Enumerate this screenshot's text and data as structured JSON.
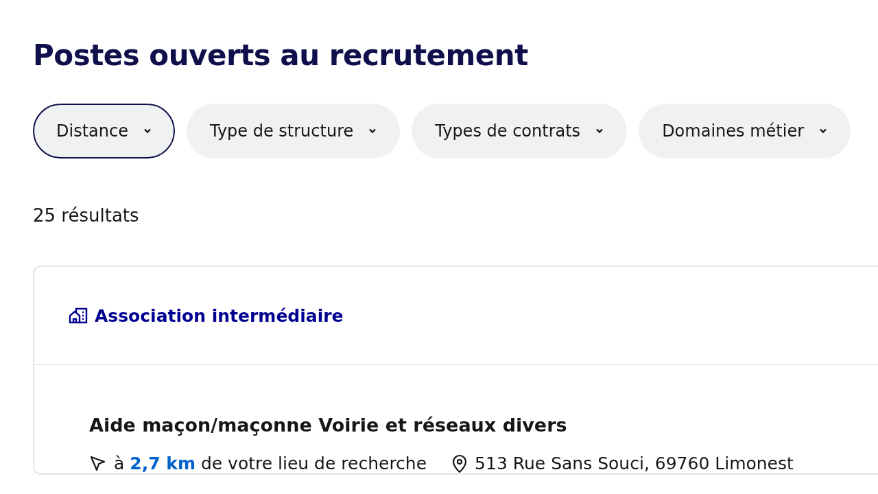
{
  "title": "Postes ouverts au recrutement",
  "filters": [
    {
      "label": "Distance",
      "selected": true
    },
    {
      "label": "Type de structure",
      "selected": false
    },
    {
      "label": "Types de contrats",
      "selected": false
    },
    {
      "label": "Domaines métier",
      "selected": false
    }
  ],
  "results_count": "25 résultats",
  "card": {
    "structure_type": "Association intermédiaire",
    "job_title": "Aide maçon/maçonne Voirie et réseaux divers",
    "distance": "à **2,7 km** de votre lieu de recherche",
    "address": "513 Rue Sans Souci, 69760 Limonest"
  }
}
